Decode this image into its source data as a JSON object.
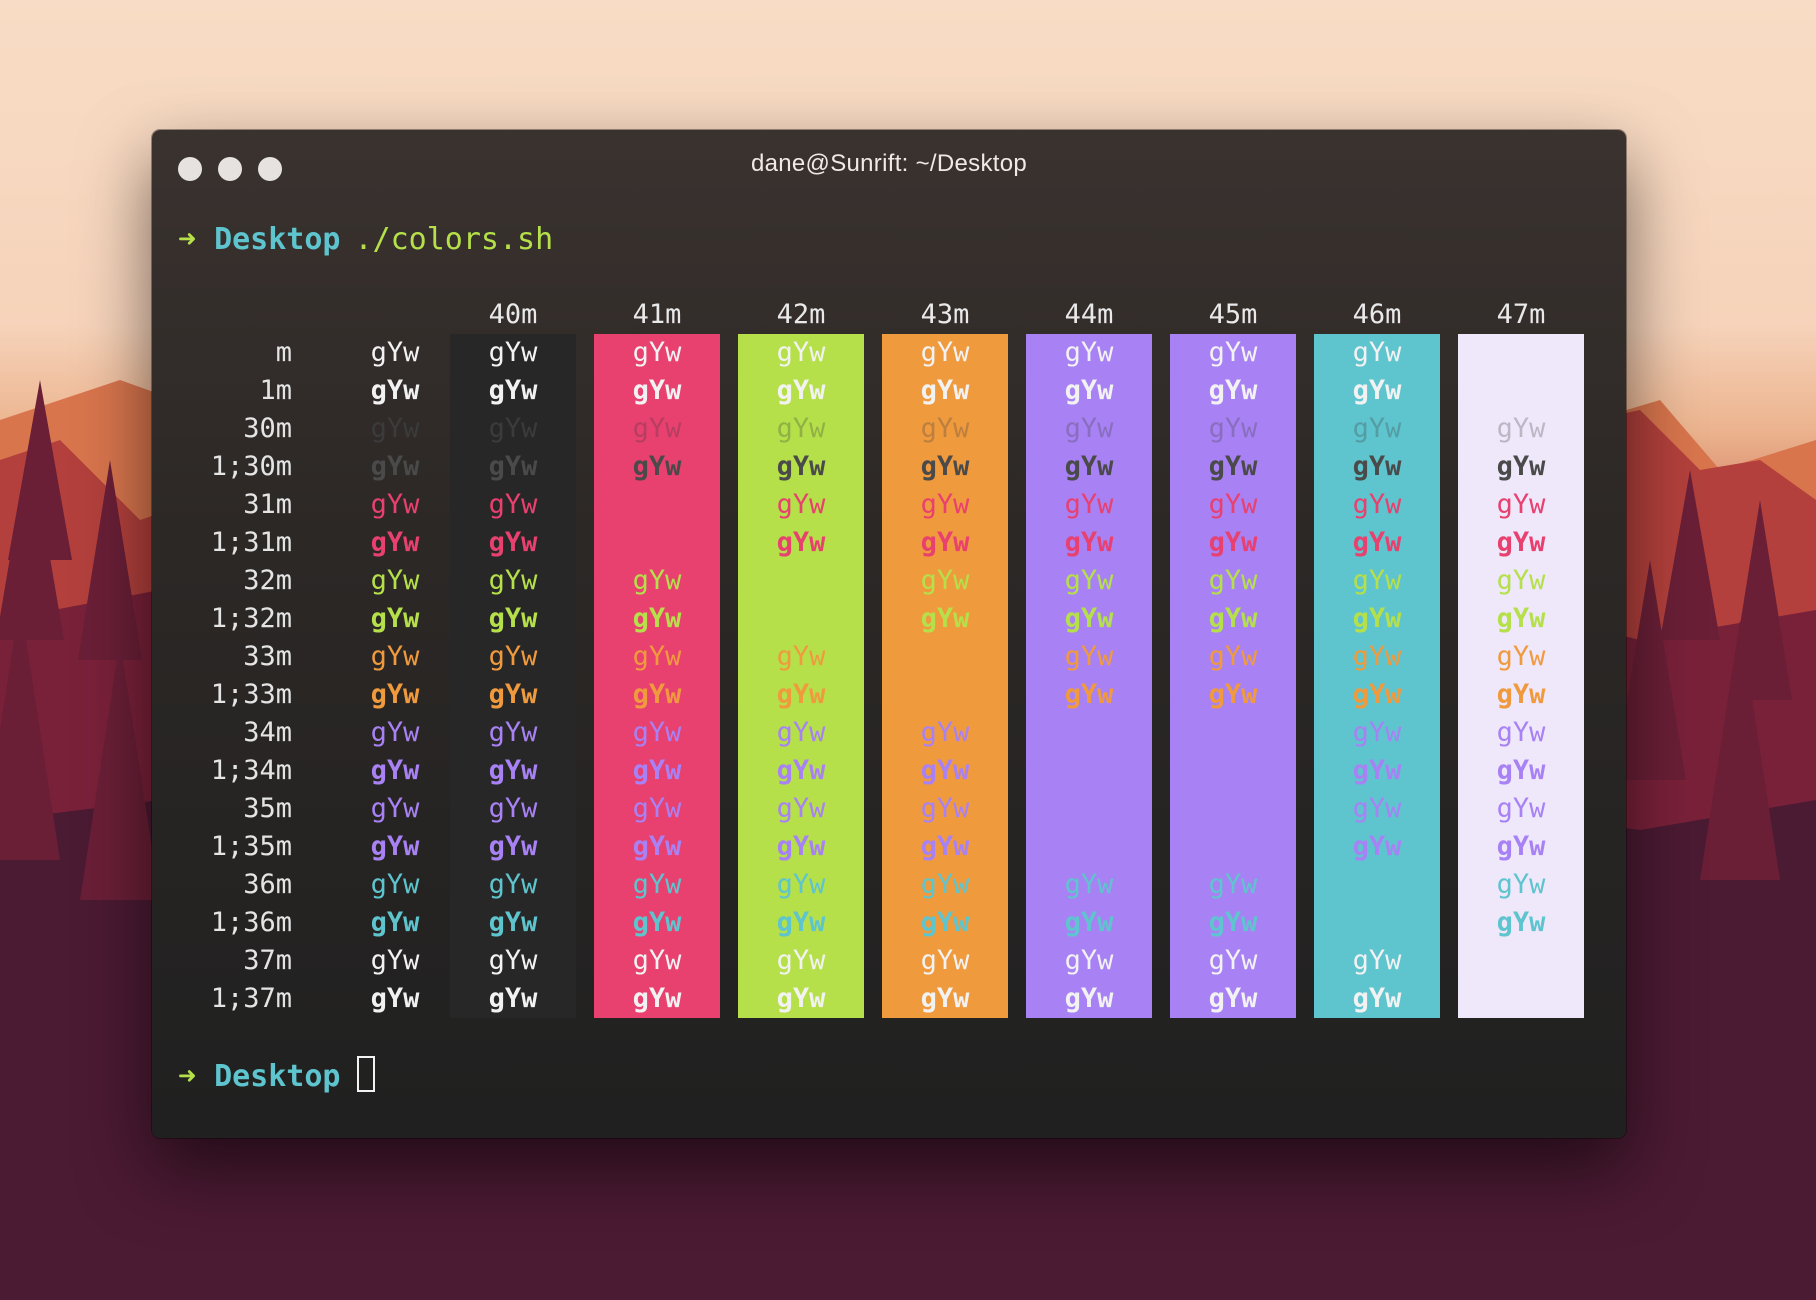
{
  "window": {
    "title": "dane@Sunrift: ~/Desktop",
    "traffic_lights": [
      "close-light",
      "minimize-light",
      "zoom-light"
    ]
  },
  "prompt1": {
    "arrow": "➜",
    "dir": "Desktop",
    "command": "./colors.sh"
  },
  "prompt2": {
    "arrow": "➜",
    "dir": "Desktop"
  },
  "colors": {
    "pink": "#e8406f",
    "green": "#b5e04a",
    "orange": "#f09a3e",
    "purple": "#a882f4",
    "cyan": "#5ec4ce",
    "white": "#efe8fb",
    "fg": "#f2f2f2",
    "gray": "#4a4a4a",
    "dim": "#3b3b3b"
  },
  "table": {
    "sample": "gYw",
    "columns": [
      {
        "label": "",
        "bg": "none"
      },
      {
        "label": "40m",
        "bg": "#272727"
      },
      {
        "label": "41m",
        "bg": "#e8406f"
      },
      {
        "label": "42m",
        "bg": "#b5e04a"
      },
      {
        "label": "43m",
        "bg": "#f09a3e"
      },
      {
        "label": "44m",
        "bg": "#a882f4"
      },
      {
        "label": "45m",
        "bg": "#a882f4"
      },
      {
        "label": "46m",
        "bg": "#5ec4ce"
      },
      {
        "label": "47m",
        "bg": "#efe8fb"
      }
    ],
    "rows": [
      {
        "label": "m",
        "fg": "#f2f2f2",
        "bold": false
      },
      {
        "label": "1m",
        "fg": "#f2f2f2",
        "bold": true
      },
      {
        "label": "30m",
        "fg": "#3b3b3b",
        "bold": false
      },
      {
        "label": "1;30m",
        "fg": "#4a4a4a",
        "bold": true
      },
      {
        "label": "31m",
        "fg": "#e8406f",
        "bold": false
      },
      {
        "label": "1;31m",
        "fg": "#e8406f",
        "bold": true
      },
      {
        "label": "32m",
        "fg": "#b5e04a",
        "bold": false
      },
      {
        "label": "1;32m",
        "fg": "#b5e04a",
        "bold": true
      },
      {
        "label": "33m",
        "fg": "#f09a3e",
        "bold": false
      },
      {
        "label": "1;33m",
        "fg": "#f09a3e",
        "bold": true
      },
      {
        "label": "34m",
        "fg": "#a882f4",
        "bold": false
      },
      {
        "label": "1;34m",
        "fg": "#a882f4",
        "bold": true
      },
      {
        "label": "35m",
        "fg": "#a882f4",
        "bold": false
      },
      {
        "label": "1;35m",
        "fg": "#a882f4",
        "bold": true
      },
      {
        "label": "36m",
        "fg": "#5ec4ce",
        "bold": false
      },
      {
        "label": "1;36m",
        "fg": "#5ec4ce",
        "bold": true
      },
      {
        "label": "37m",
        "fg": "#f2f2f2",
        "bold": false
      },
      {
        "label": "1;37m",
        "fg": "#f2f2f2",
        "bold": true
      }
    ]
  }
}
